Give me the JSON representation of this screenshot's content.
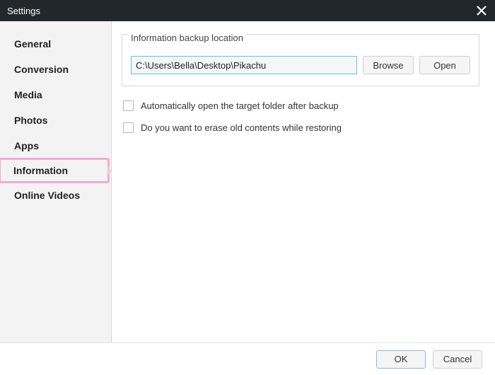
{
  "titlebar": {
    "title": "Settings"
  },
  "sidebar": {
    "items": [
      {
        "label": "General"
      },
      {
        "label": "Conversion"
      },
      {
        "label": "Media"
      },
      {
        "label": "Photos"
      },
      {
        "label": "Apps"
      },
      {
        "label": "Information"
      },
      {
        "label": "Online Videos"
      }
    ],
    "active_index": 5
  },
  "main": {
    "fieldset": {
      "legend": "Information backup location",
      "path": "C:\\Users\\Bella\\Desktop\\Pikachu",
      "browse_label": "Browse",
      "open_label": "Open"
    },
    "checks": [
      {
        "label": "Automatically open the target folder after backup",
        "checked": false
      },
      {
        "label": "Do you want to erase old contents while restoring",
        "checked": false
      }
    ]
  },
  "footer": {
    "ok_label": "OK",
    "cancel_label": "Cancel"
  }
}
